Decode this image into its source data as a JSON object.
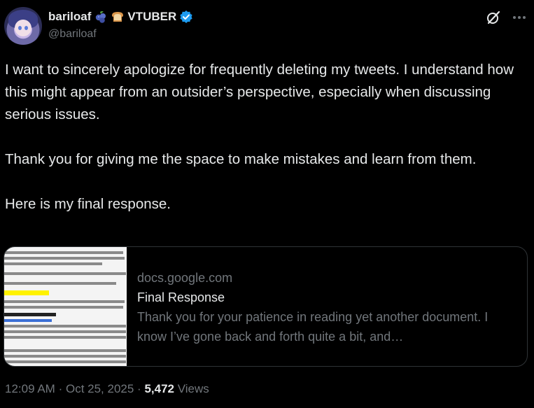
{
  "user": {
    "display_name": "bariloaf",
    "name_suffix": "VTUBER",
    "handle": "@bariloaf",
    "emoji": [
      "blueberries-emoji",
      "bread-emoji"
    ],
    "verified_color": "#1d9bf0"
  },
  "tweet": {
    "paragraphs": [
      "I want to sincerely apologize for frequently deleting my tweets. I understand how this might appear from an outsider’s perspective, especially when discussing serious issues.",
      "Thank you for giving me the space to make mistakes and learn from them.",
      "Here is my final response."
    ]
  },
  "card": {
    "domain": "docs.google.com",
    "title": "Final Response",
    "description": "Thank you for your patience in reading yet another document. I know I’ve gone back and forth quite a bit, and…"
  },
  "meta": {
    "time": "12:09 AM",
    "separator": "·",
    "date": "Oct 25, 2025",
    "views_count": "5,472",
    "views_label": "Views"
  },
  "icons": {
    "grok": "grok-icon",
    "more": "more-icon"
  },
  "colors": {
    "background": "#000000",
    "text": "#e7e9ea",
    "secondary": "#71767b",
    "border": "#2f3336"
  }
}
